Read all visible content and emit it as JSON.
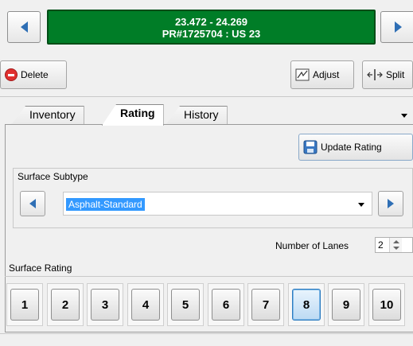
{
  "header": {
    "route_line1": "23.472 - 24.269",
    "route_line2": "PR#1725704 : US 23"
  },
  "toolbar": {
    "delete_label": "Delete",
    "adjust_label": "Adjust",
    "split_label": "Split"
  },
  "tabs": [
    {
      "label": "Inventory"
    },
    {
      "label": "Rating"
    },
    {
      "label": "History"
    }
  ],
  "rating_panel": {
    "update_label": "Update Rating",
    "surface_subtype_label": "Surface Subtype",
    "surface_subtype_value": "Asphalt-Standard",
    "lanes_label": "Number of Lanes",
    "lanes_value": "2",
    "surface_rating_label": "Surface Rating",
    "ratings": [
      "1",
      "2",
      "3",
      "4",
      "5",
      "6",
      "7",
      "8",
      "9",
      "10"
    ],
    "selected_rating": "8"
  },
  "colors": {
    "banner_bg": "#007d27",
    "nav_arrow": "#2f6fb5",
    "selection": "#3399ff"
  }
}
